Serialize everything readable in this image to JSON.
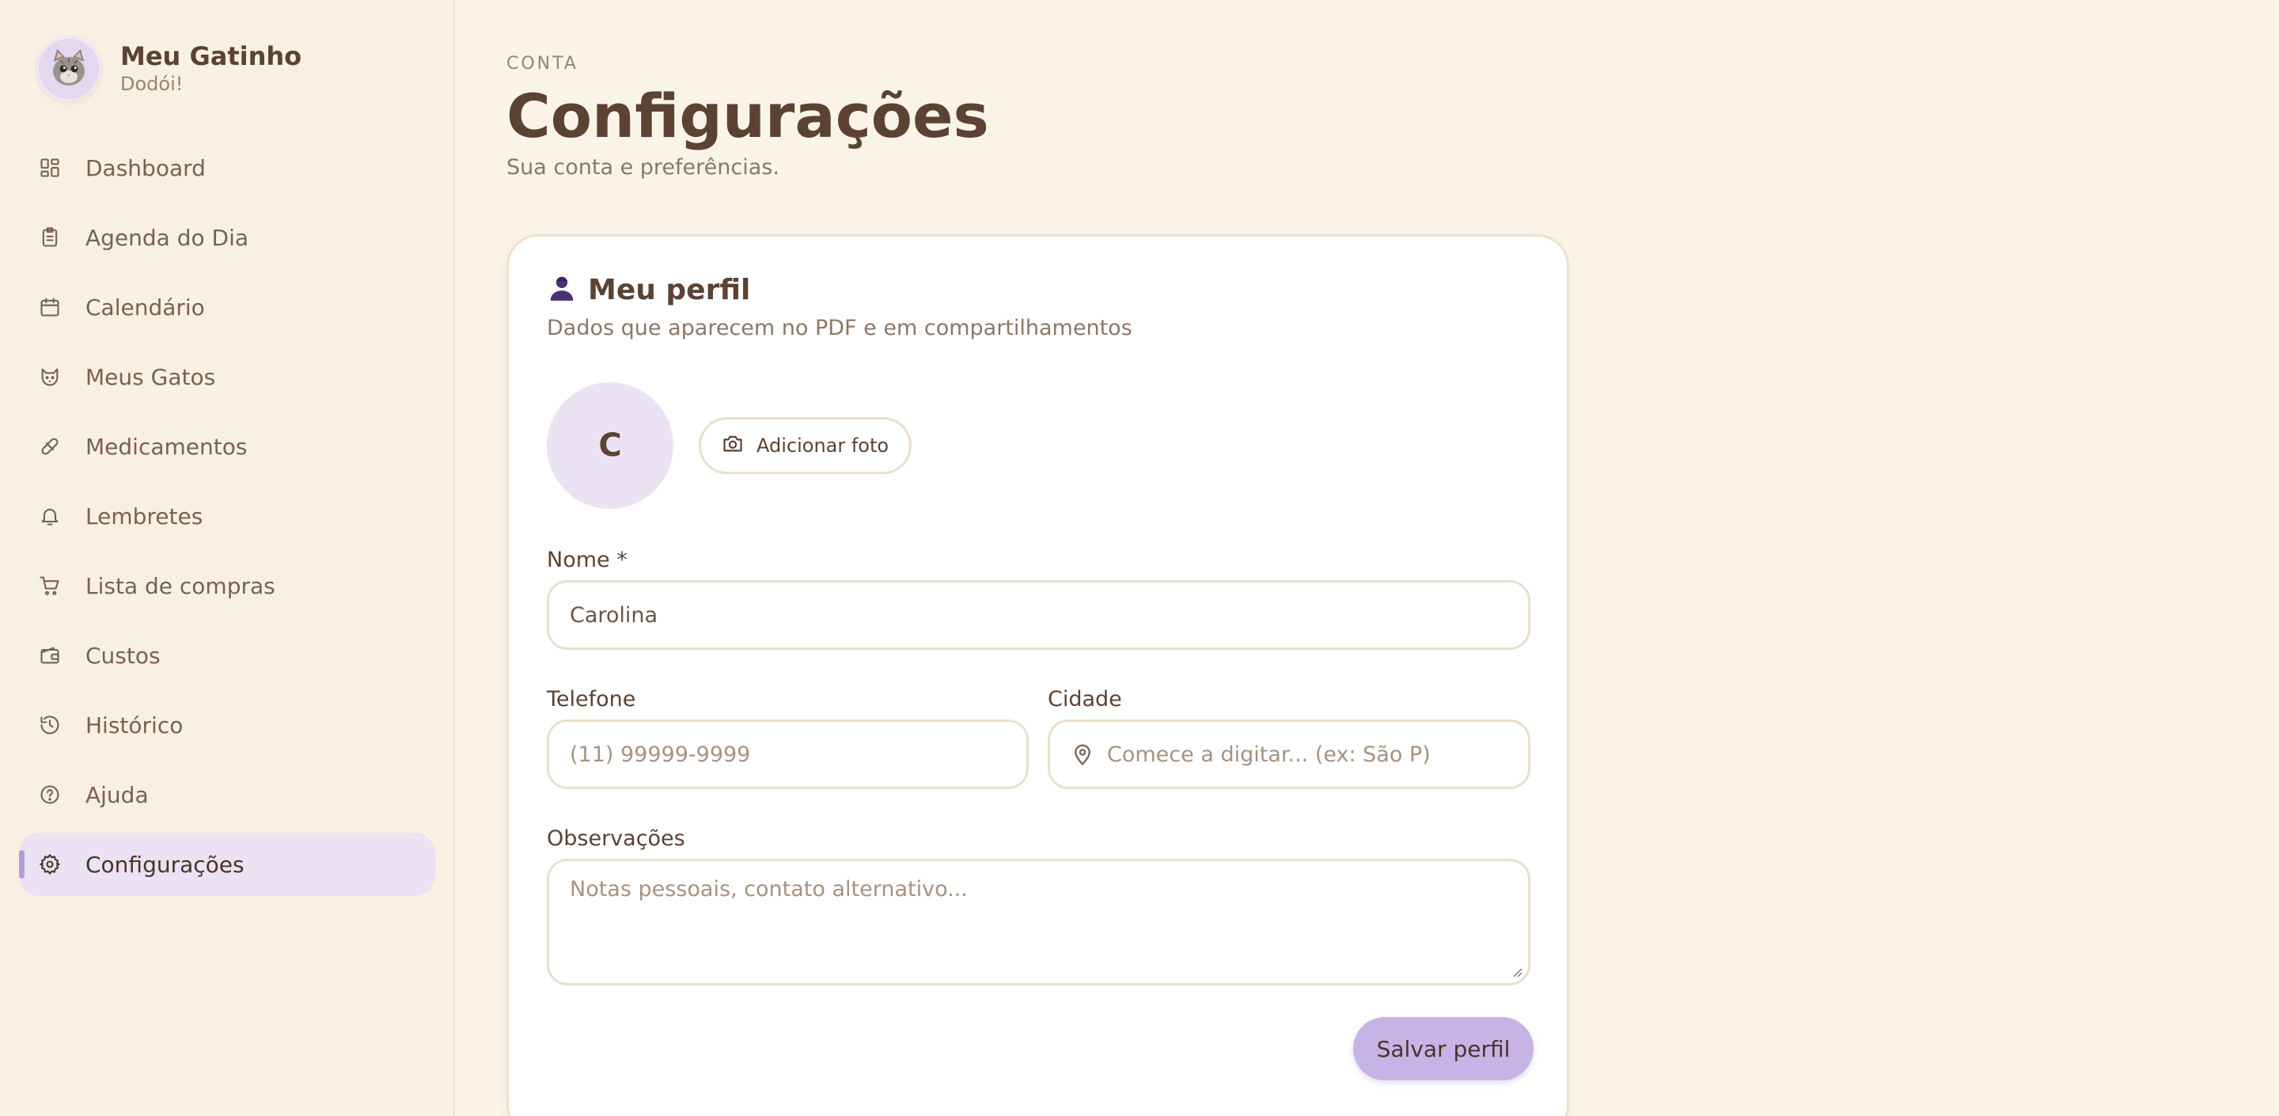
{
  "brand": {
    "title": "Meu Gatinho",
    "subtitle": "Dodói!"
  },
  "nav": {
    "items": [
      {
        "label": "Dashboard",
        "icon": "dashboard-icon"
      },
      {
        "label": "Agenda do Dia",
        "icon": "clipboard-icon"
      },
      {
        "label": "Calendário",
        "icon": "calendar-icon"
      },
      {
        "label": "Meus Gatos",
        "icon": "cat-icon"
      },
      {
        "label": "Medicamentos",
        "icon": "pill-icon"
      },
      {
        "label": "Lembretes",
        "icon": "bell-icon"
      },
      {
        "label": "Lista de compras",
        "icon": "cart-icon"
      },
      {
        "label": "Custos",
        "icon": "wallet-icon"
      },
      {
        "label": "Histórico",
        "icon": "history-icon"
      },
      {
        "label": "Ajuda",
        "icon": "help-icon"
      },
      {
        "label": "Configurações",
        "icon": "gear-icon",
        "active": true
      }
    ]
  },
  "page": {
    "eyebrow": "CONTA",
    "title": "Configurações",
    "subtitle": "Sua conta e preferências."
  },
  "profile": {
    "title": "Meu perfil",
    "description": "Dados que aparecem no PDF e em compartilhamentos",
    "avatar_initial": "C",
    "add_photo_label": "Adicionar foto",
    "name_label": "Nome *",
    "name_value": "Carolina",
    "phone_label": "Telefone",
    "phone_placeholder": "(11) 99999-9999",
    "city_label": "Cidade",
    "city_placeholder": "Comece a digitar... (ex: São P)",
    "notes_label": "Observações",
    "notes_placeholder": "Notas pessoais, contato alternativo...",
    "save_label": "Salvar perfil"
  },
  "colors": {
    "background": "#faf3e8",
    "accent": "#c8b3e6",
    "active_nav": "#ebe2f3",
    "text": "#5b4233"
  }
}
